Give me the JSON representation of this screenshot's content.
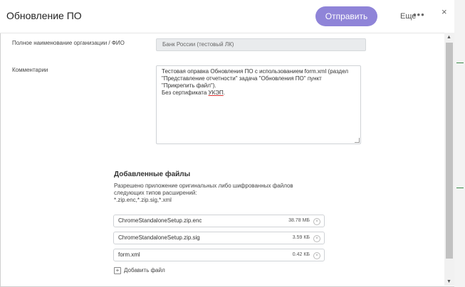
{
  "header": {
    "title": "Обновление ПО",
    "send_label": "Отправить",
    "more_label": "Еще",
    "more_dots": "•••",
    "close": "×"
  },
  "form": {
    "org_label": "Полное наименование организации / ФИО",
    "org_value": "Банк России (тестовый ЛК)",
    "comment_label": "Комментарии",
    "comment_text": "Тестовая оправка Обновления ПО с использованием form.xml (раздел \"Представление отчетности\" задача \"Обновления ПО\" пункт \"Прикрепить файл\").\nБез сертификата ",
    "comment_abbr": "УКЭП",
    "comment_end": "."
  },
  "files": {
    "title": "Добавленные файлы",
    "description": "Разрешено приложение оригинальных либо шифрованных файлов следующих типов расширений:\n*.zip.enc,*.zip.sig,*.xml",
    "items": [
      {
        "name": "ChromeStandaloneSetup.zip.enc",
        "size": "38.78 МБ"
      },
      {
        "name": "ChromeStandaloneSetup.zip.sig",
        "size": "3.59 КБ"
      },
      {
        "name": "form.xml",
        "size": "0.42 КБ"
      }
    ],
    "add_label": "Добавить файл"
  },
  "colors": {
    "accent": "#8f84d8"
  }
}
